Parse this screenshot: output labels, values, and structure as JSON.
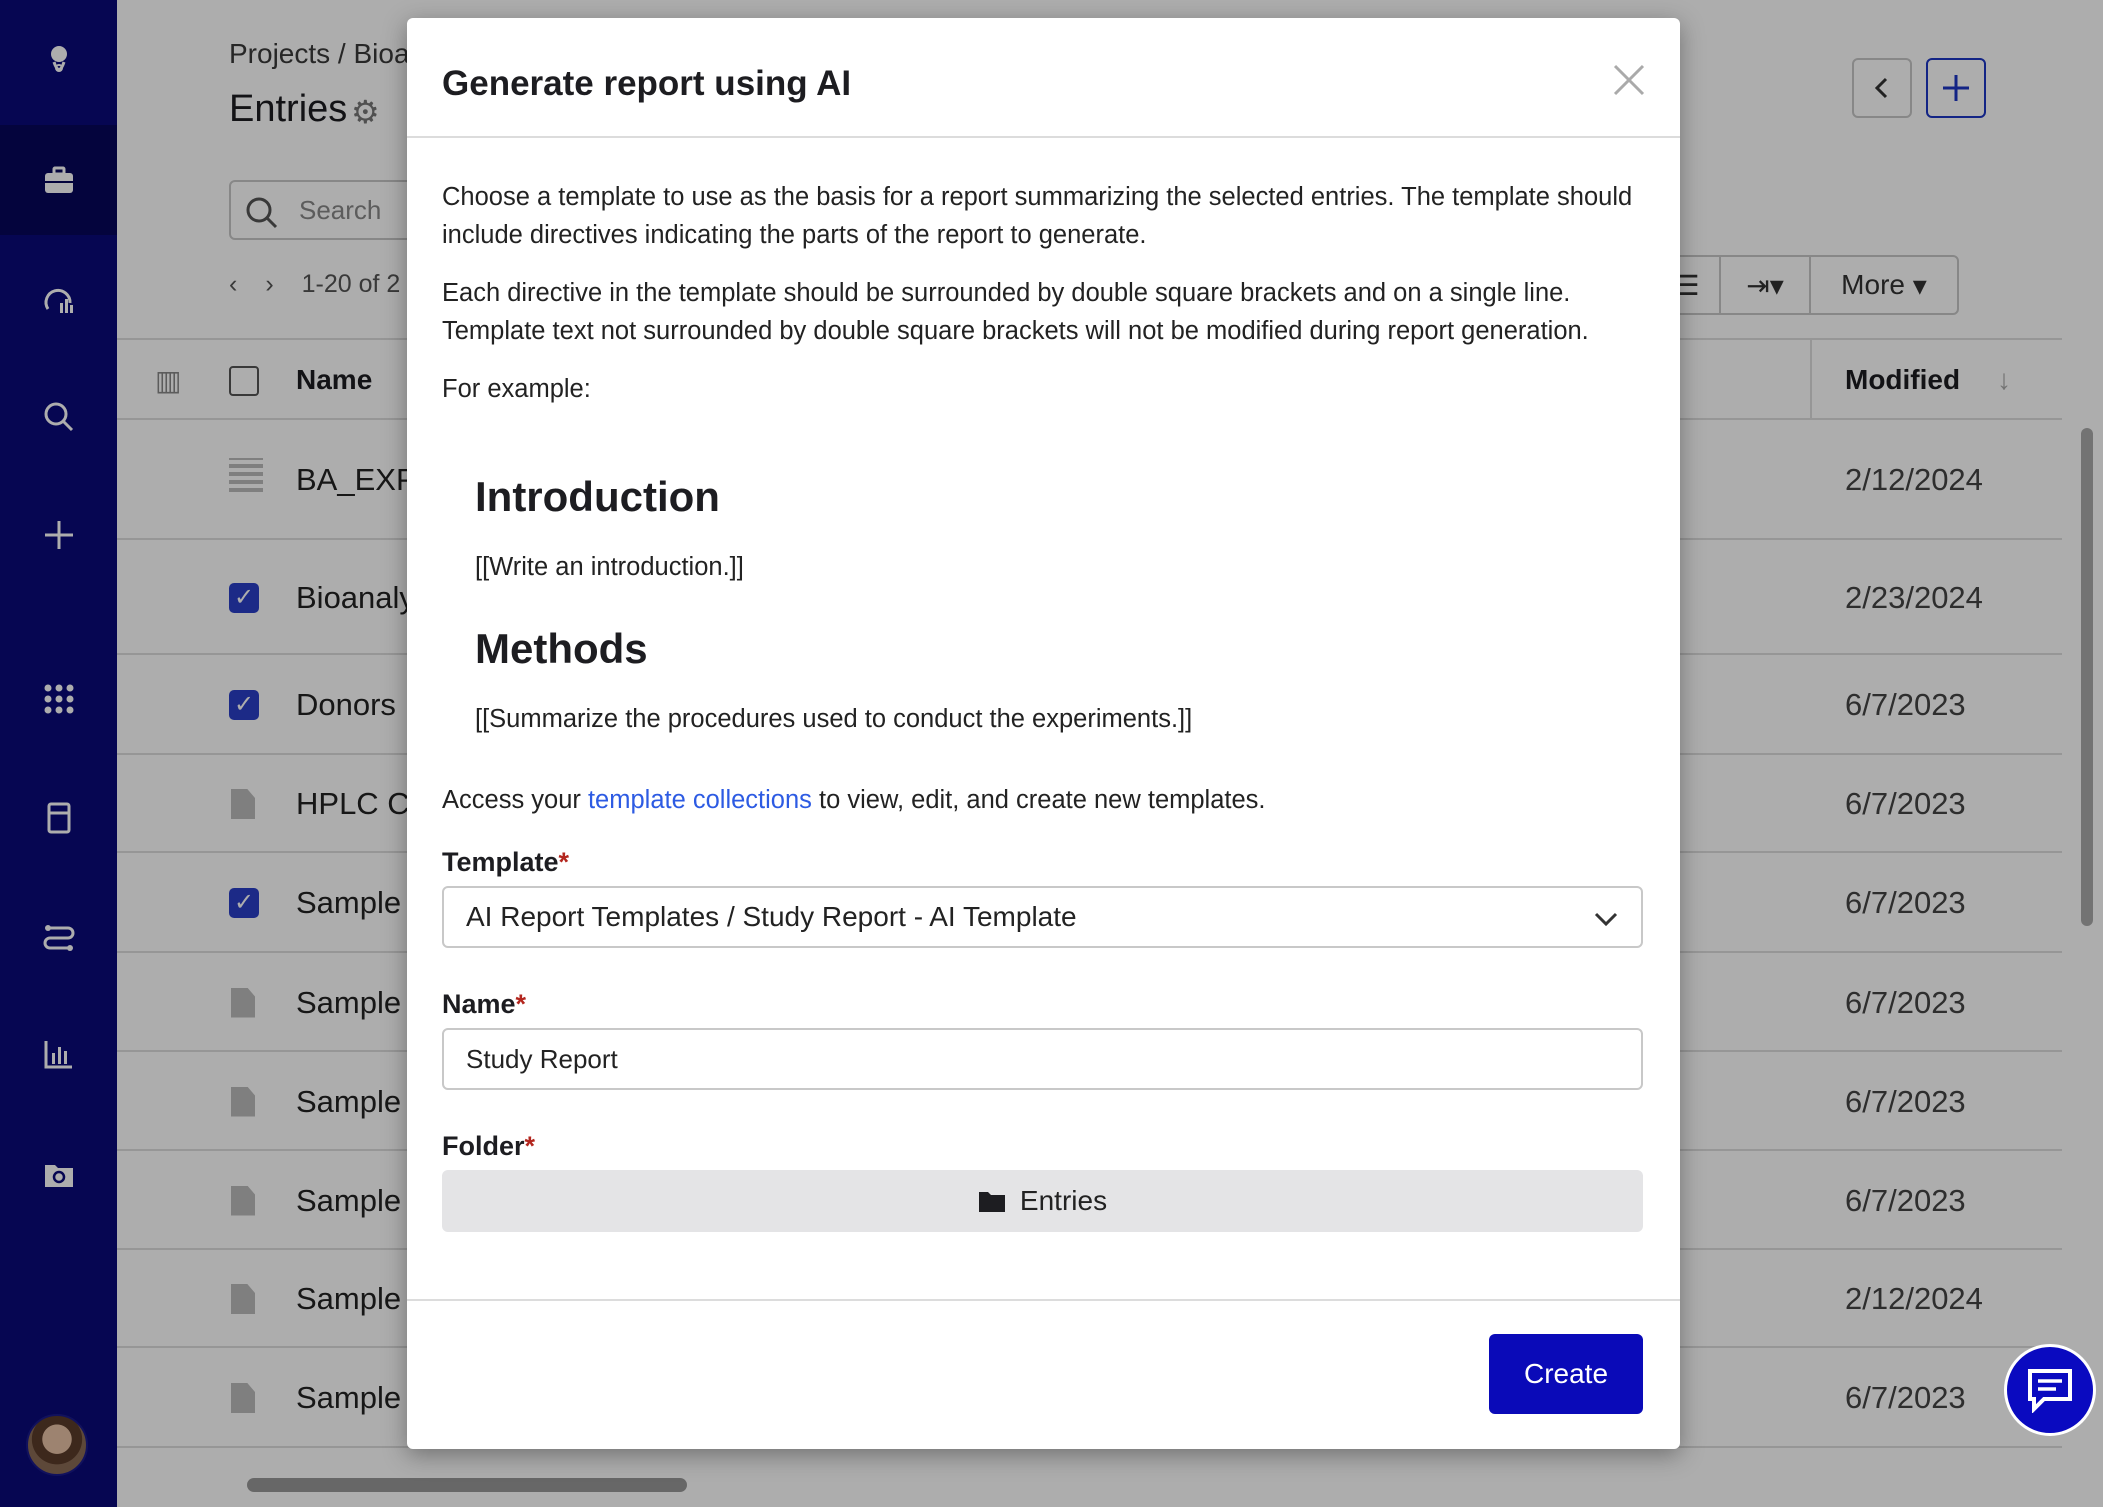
{
  "sidebar": {
    "items": [
      {
        "icon": "logo-icon"
      },
      {
        "icon": "briefcase-icon"
      },
      {
        "icon": "dashboard-icon"
      },
      {
        "icon": "search-icon"
      },
      {
        "icon": "plus-icon"
      },
      {
        "icon": "apps-grid-icon"
      },
      {
        "icon": "notebook-icon"
      },
      {
        "icon": "workflow-icon"
      },
      {
        "icon": "chart-icon"
      },
      {
        "icon": "folder-sync-icon"
      }
    ]
  },
  "page": {
    "breadcrumb": "Projects / Bioa",
    "title": "Entries",
    "search_placeholder": "Search",
    "pager_text": "1-20 of 2",
    "toolbar_more": "More",
    "columns": {
      "name": "Name",
      "modified": "Modified"
    },
    "rows": [
      {
        "name": "BA_EXP",
        "modified": "2/12/2024",
        "checked": false,
        "type": "dataset"
      },
      {
        "name": "Bioanaly",
        "modified": "2/23/2024",
        "checked": true,
        "type": "entry"
      },
      {
        "name": "Donors",
        "modified": "6/7/2023",
        "checked": true,
        "type": "entry"
      },
      {
        "name": "HPLC Ca",
        "modified": "6/7/2023",
        "checked": false,
        "type": "file"
      },
      {
        "name": "Sample",
        "modified": "6/7/2023",
        "checked": true,
        "type": "entry"
      },
      {
        "name": "Sample",
        "modified": "6/7/2023",
        "checked": false,
        "type": "file"
      },
      {
        "name": "Sample",
        "modified": "6/7/2023",
        "checked": false,
        "type": "file"
      },
      {
        "name": "Sample",
        "modified": "6/7/2023",
        "checked": false,
        "type": "file"
      },
      {
        "name": "Sample",
        "modified": "2/12/2024",
        "checked": false,
        "type": "file"
      },
      {
        "name": "Sample",
        "modified": "6/7/2023",
        "checked": false,
        "type": "file"
      }
    ]
  },
  "modal": {
    "title": "Generate report using AI",
    "intro": "Choose a template to use as the basis for a report summarizing the selected entries. The template should include directives indicating the parts of the report to generate.",
    "directive_note": "Each directive in the template should be surrounded by double square brackets and on a single line. Template text not surrounded by double square brackets will not be modified during report generation.",
    "example_label": "For example:",
    "example": {
      "heading1": "Introduction",
      "text1": "[[Write an introduction.]]",
      "heading2": "Methods",
      "text2": "[[Summarize the procedures used to conduct the experiments.]]"
    },
    "access_prefix": "Access your ",
    "access_link": "template collections",
    "access_suffix": " to view, edit, and create new templates.",
    "template_label": "Template",
    "template_value": "AI Report Templates / Study Report - AI Template",
    "name_label": "Name",
    "name_value": "Study Report",
    "folder_label": "Folder",
    "folder_value": "Entries",
    "required_mark": "*",
    "create_label": "Create"
  },
  "colors": {
    "sidebar": "#0a0a7a",
    "primary": "#0a0ab8",
    "link": "#2d5be3",
    "required": "#b3261e"
  }
}
